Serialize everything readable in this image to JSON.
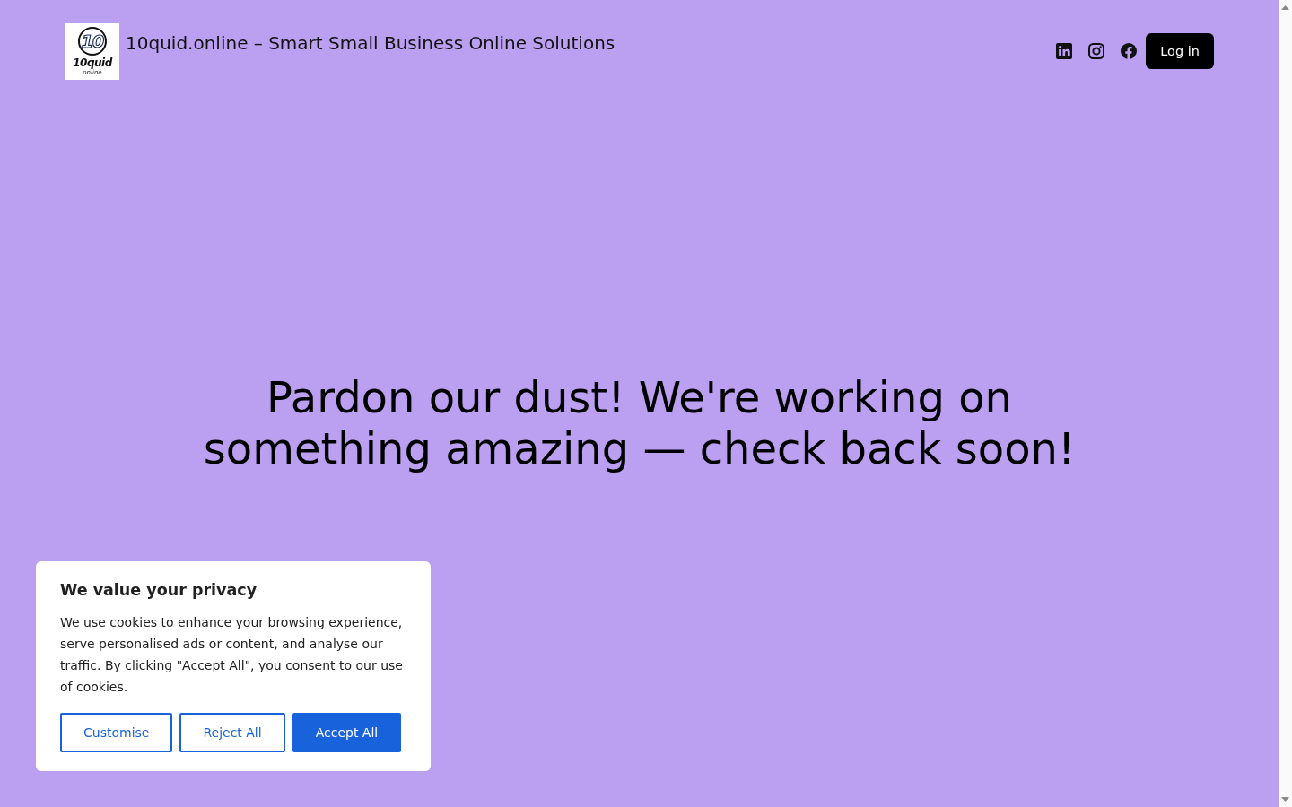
{
  "header": {
    "logo": {
      "mark": "10",
      "name": "10quid",
      "tagline": "online"
    },
    "site_title": "10quid.online – Smart Small Business Online Solutions",
    "social_links": [
      {
        "kind": "linkedin"
      },
      {
        "kind": "instagram"
      },
      {
        "kind": "facebook"
      }
    ],
    "login_button": "Log in"
  },
  "main": {
    "heading": "Pardon our dust! We're working on something amazing — check back soon!"
  },
  "cookie_banner": {
    "title": "We value your privacy",
    "text": "We use cookies to enhance your browsing experience, serve personalised ads or content, and analyse our traffic. By clicking \"Accept All\", you consent to our use of cookies.",
    "buttons": [
      {
        "label": "Customise",
        "kind": "outline"
      },
      {
        "label": "Reject All",
        "kind": "outline"
      },
      {
        "label": "Accept All",
        "kind": "primary"
      }
    ]
  }
}
